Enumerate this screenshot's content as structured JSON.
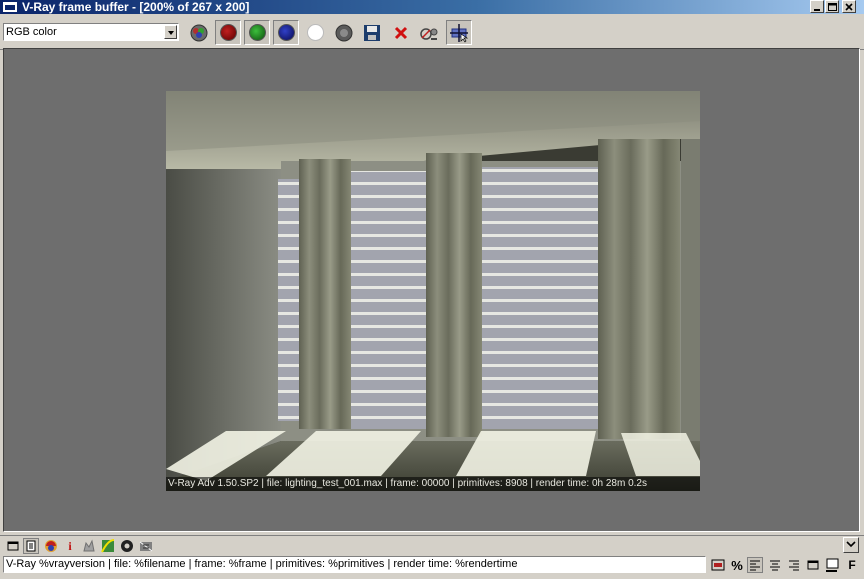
{
  "window": {
    "title": "V-Ray frame buffer - [200% of 267 x 200]",
    "controls": {
      "minimize_icon": "minimize-icon",
      "maximize_icon": "maximize-icon",
      "close_icon": "close-icon"
    }
  },
  "toolbar": {
    "channel_select": {
      "selected": "RGB color"
    },
    "buttons": [
      {
        "name": "show-rgb-channels-button",
        "icon": "rgb-channels-icon"
      },
      {
        "name": "red-channel-button",
        "icon": "red-channel-icon",
        "color": "#8b0000",
        "pressed": true
      },
      {
        "name": "green-channel-button",
        "icon": "green-channel-icon",
        "color": "#1f7a1f",
        "pressed": true
      },
      {
        "name": "blue-channel-button",
        "icon": "blue-channel-icon",
        "color": "#1a1a8c",
        "pressed": true
      },
      {
        "name": "alpha-channel-button",
        "icon": "alpha-channel-icon",
        "color": "#ffffff"
      },
      {
        "name": "monochrome-button",
        "icon": "monochrome-icon"
      },
      {
        "name": "save-image-button",
        "icon": "floppy-disk-icon"
      },
      {
        "name": "clear-image-button",
        "icon": "red-x-icon"
      },
      {
        "name": "duplicate-to-max-vfb-button",
        "icon": "duplicate-icon"
      },
      {
        "name": "track-mouse-button",
        "icon": "crosshair-icon",
        "pressed": true
      }
    ]
  },
  "render": {
    "stamp": "V-Ray Adv 1.50.SP2 | file: lighting_test_001.max | frame: 00000 | primitives: 8908 | render time: 0h 28m 0.2s"
  },
  "bottombar": {
    "icons": [
      "frame-icon",
      "history-icon",
      "color-correction-icon",
      "info-icon",
      "lens-effects-icon",
      "curve-icon",
      "settings-icon",
      "compare-icon"
    ],
    "expand_icon": "chevron-down-icon",
    "stamp_template": "V-Ray %vrayversion | file: %filename | frame: %frame | primitives: %primitives | render time: %rendertime",
    "right_buttons": [
      {
        "name": "insert-token-button",
        "icon": "token-icon"
      },
      {
        "name": "percent-button",
        "label": "%"
      },
      {
        "name": "align-left-button",
        "icon": "align-left-icon"
      },
      {
        "name": "align-center-button",
        "icon": "align-center-icon"
      },
      {
        "name": "align-right-button",
        "icon": "align-right-icon"
      },
      {
        "name": "stamp-frame-button",
        "icon": "frame-icon"
      },
      {
        "name": "stamp-background-button",
        "icon": "background-icon"
      },
      {
        "name": "font-button",
        "label": "F"
      }
    ]
  }
}
